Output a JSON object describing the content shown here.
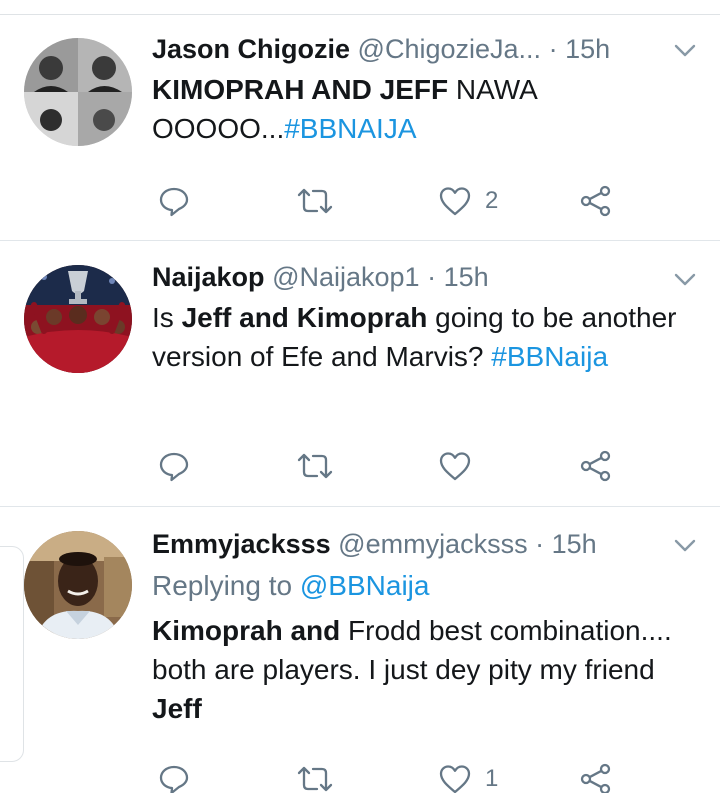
{
  "tweets": [
    {
      "display_name": "Jason Chigozie",
      "handle": "@ChigozieJa...",
      "separator": "·",
      "time": "15h",
      "body_parts": [
        {
          "text": "KIMOPRAH AND JEFF",
          "style": "bold"
        },
        {
          "text": " NAWA OOOOO...",
          "style": "plain"
        },
        {
          "text": "#BBNAIJA",
          "style": "hashtag"
        }
      ],
      "likes": "2"
    },
    {
      "display_name": "Naijakop",
      "handle": "@Naijakop1",
      "separator": "·",
      "time": "15h",
      "body_parts": [
        {
          "text": "Is ",
          "style": "plain"
        },
        {
          "text": "Jeff and Kimoprah",
          "style": "bold"
        },
        {
          "text": " going to be another version of Efe and Marvis? ",
          "style": "plain"
        },
        {
          "text": "#BBNaija",
          "style": "hashtag"
        }
      ],
      "likes": ""
    },
    {
      "display_name": "Emmyjacksss",
      "handle": "@emmyjacksss",
      "separator": "·",
      "time": "15h",
      "replying_to_label": "Replying to",
      "replying_to_handle": "@BBNaija",
      "body_parts": [
        {
          "text": "Kimoprah and",
          "style": "bold"
        },
        {
          "text": " Frodd best combination.... both are players. I just dey pity my friend ",
          "style": "plain"
        },
        {
          "text": "Jeff",
          "style": "bold"
        }
      ],
      "likes": "1"
    }
  ],
  "icons": {
    "reply": "reply-icon",
    "retweet": "retweet-icon",
    "like": "heart-icon",
    "share": "share-icon",
    "more": "chevron-down-icon"
  },
  "colors": {
    "link": "#1b95e0",
    "secondary_text": "#657786",
    "primary_text": "#14171a",
    "divider": "#e1e6ea"
  }
}
